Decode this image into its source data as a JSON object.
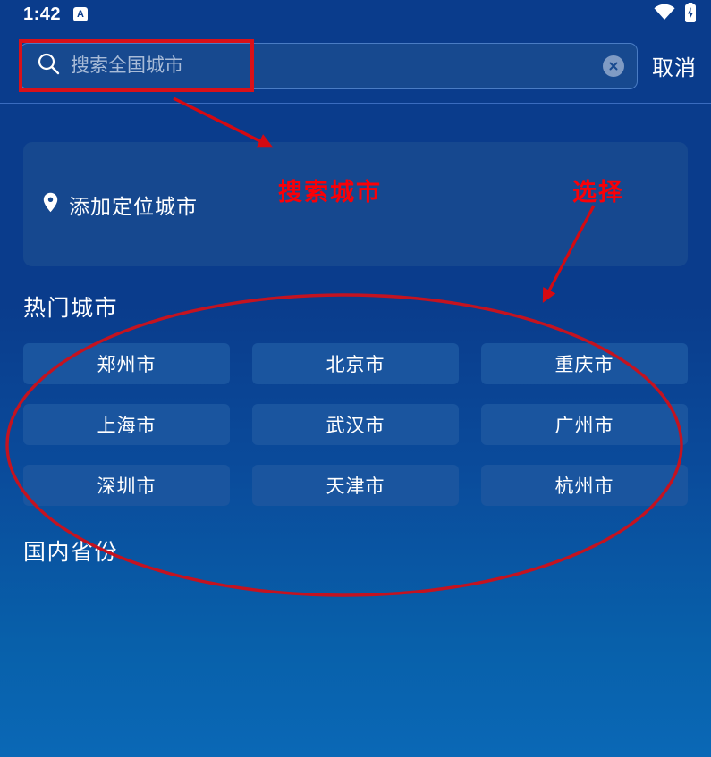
{
  "status_bar": {
    "time": "1:42",
    "ime_badge": "A",
    "icons": [
      "ime-badge-icon",
      "wifi-icon",
      "battery-charging-icon"
    ]
  },
  "search": {
    "placeholder": "搜索全国城市",
    "value": "",
    "search_icon": "search-icon",
    "clear_icon": "clear-circle-icon",
    "cancel_label": "取消"
  },
  "locate_card": {
    "label": "添加定位城市",
    "icon": "location-pin-icon"
  },
  "hot_cities": {
    "title": "热门城市",
    "items": [
      "郑州市",
      "北京市",
      "重庆市",
      "上海市",
      "武汉市",
      "广州市",
      "深圳市",
      "天津市",
      "杭州市"
    ]
  },
  "provinces": {
    "title": "国内省份"
  },
  "annotations": {
    "color": "#fb0007",
    "search_label": "搜索城市",
    "select_label": "选择",
    "shapes": [
      "red-rect-around-search",
      "arrow-to-locate-card",
      "arrow-to-city-grid",
      "red-ellipse-around-cities"
    ]
  },
  "colors": {
    "page_background_top": "#0a3c8c",
    "page_background_bottom": "#0a68b6",
    "card": "#16488f",
    "city_cell": "#1a559f",
    "search_field": "#17498f",
    "annotation_red": "#fb0007",
    "text_primary": "#ffffff",
    "placeholder": "#a9bcd8"
  }
}
